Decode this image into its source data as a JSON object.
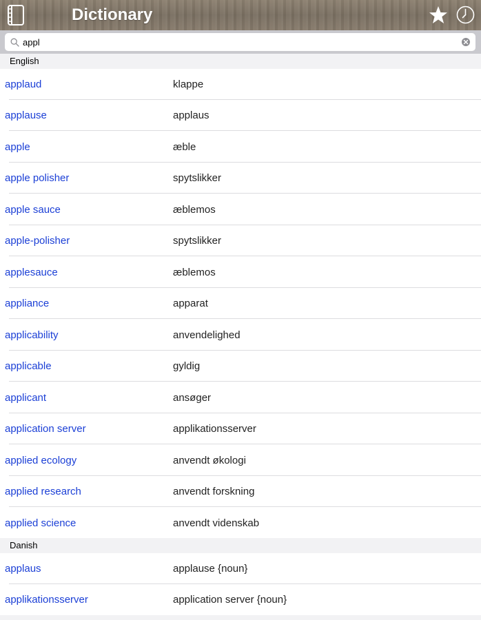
{
  "header": {
    "title": "Dictionary",
    "icons": [
      "book-icon",
      "star-icon",
      "clock-icon"
    ]
  },
  "search": {
    "value": "appl",
    "placeholder": ""
  },
  "sections": [
    {
      "title": "English",
      "rows": [
        {
          "term": "applaud",
          "translation": "klappe"
        },
        {
          "term": "applause",
          "translation": "applaus"
        },
        {
          "term": "apple",
          "translation": "æble"
        },
        {
          "term": "apple polisher",
          "translation": "spytslikker"
        },
        {
          "term": "apple sauce",
          "translation": "æblemos"
        },
        {
          "term": "apple-polisher",
          "translation": "spytslikker"
        },
        {
          "term": "applesauce",
          "translation": "æblemos"
        },
        {
          "term": "appliance",
          "translation": "apparat"
        },
        {
          "term": "applicability",
          "translation": "anvendelighed"
        },
        {
          "term": "applicable",
          "translation": "gyldig"
        },
        {
          "term": "applicant",
          "translation": "ansøger"
        },
        {
          "term": "application server",
          "translation": "applikationsserver"
        },
        {
          "term": "applied ecology",
          "translation": "anvendt økologi"
        },
        {
          "term": "applied research",
          "translation": "anvendt forskning"
        },
        {
          "term": "applied science",
          "translation": "anvendt videnskab"
        }
      ]
    },
    {
      "title": "Danish",
      "rows": [
        {
          "term": "applaus",
          "translation": "applause {noun}"
        },
        {
          "term": "applikationsserver",
          "translation": "application server {noun}"
        }
      ]
    }
  ],
  "colors": {
    "term": "#1b3fd6",
    "translation": "#222222",
    "section_bg": "#f2f2f4",
    "separator": "#dcdcdf"
  }
}
